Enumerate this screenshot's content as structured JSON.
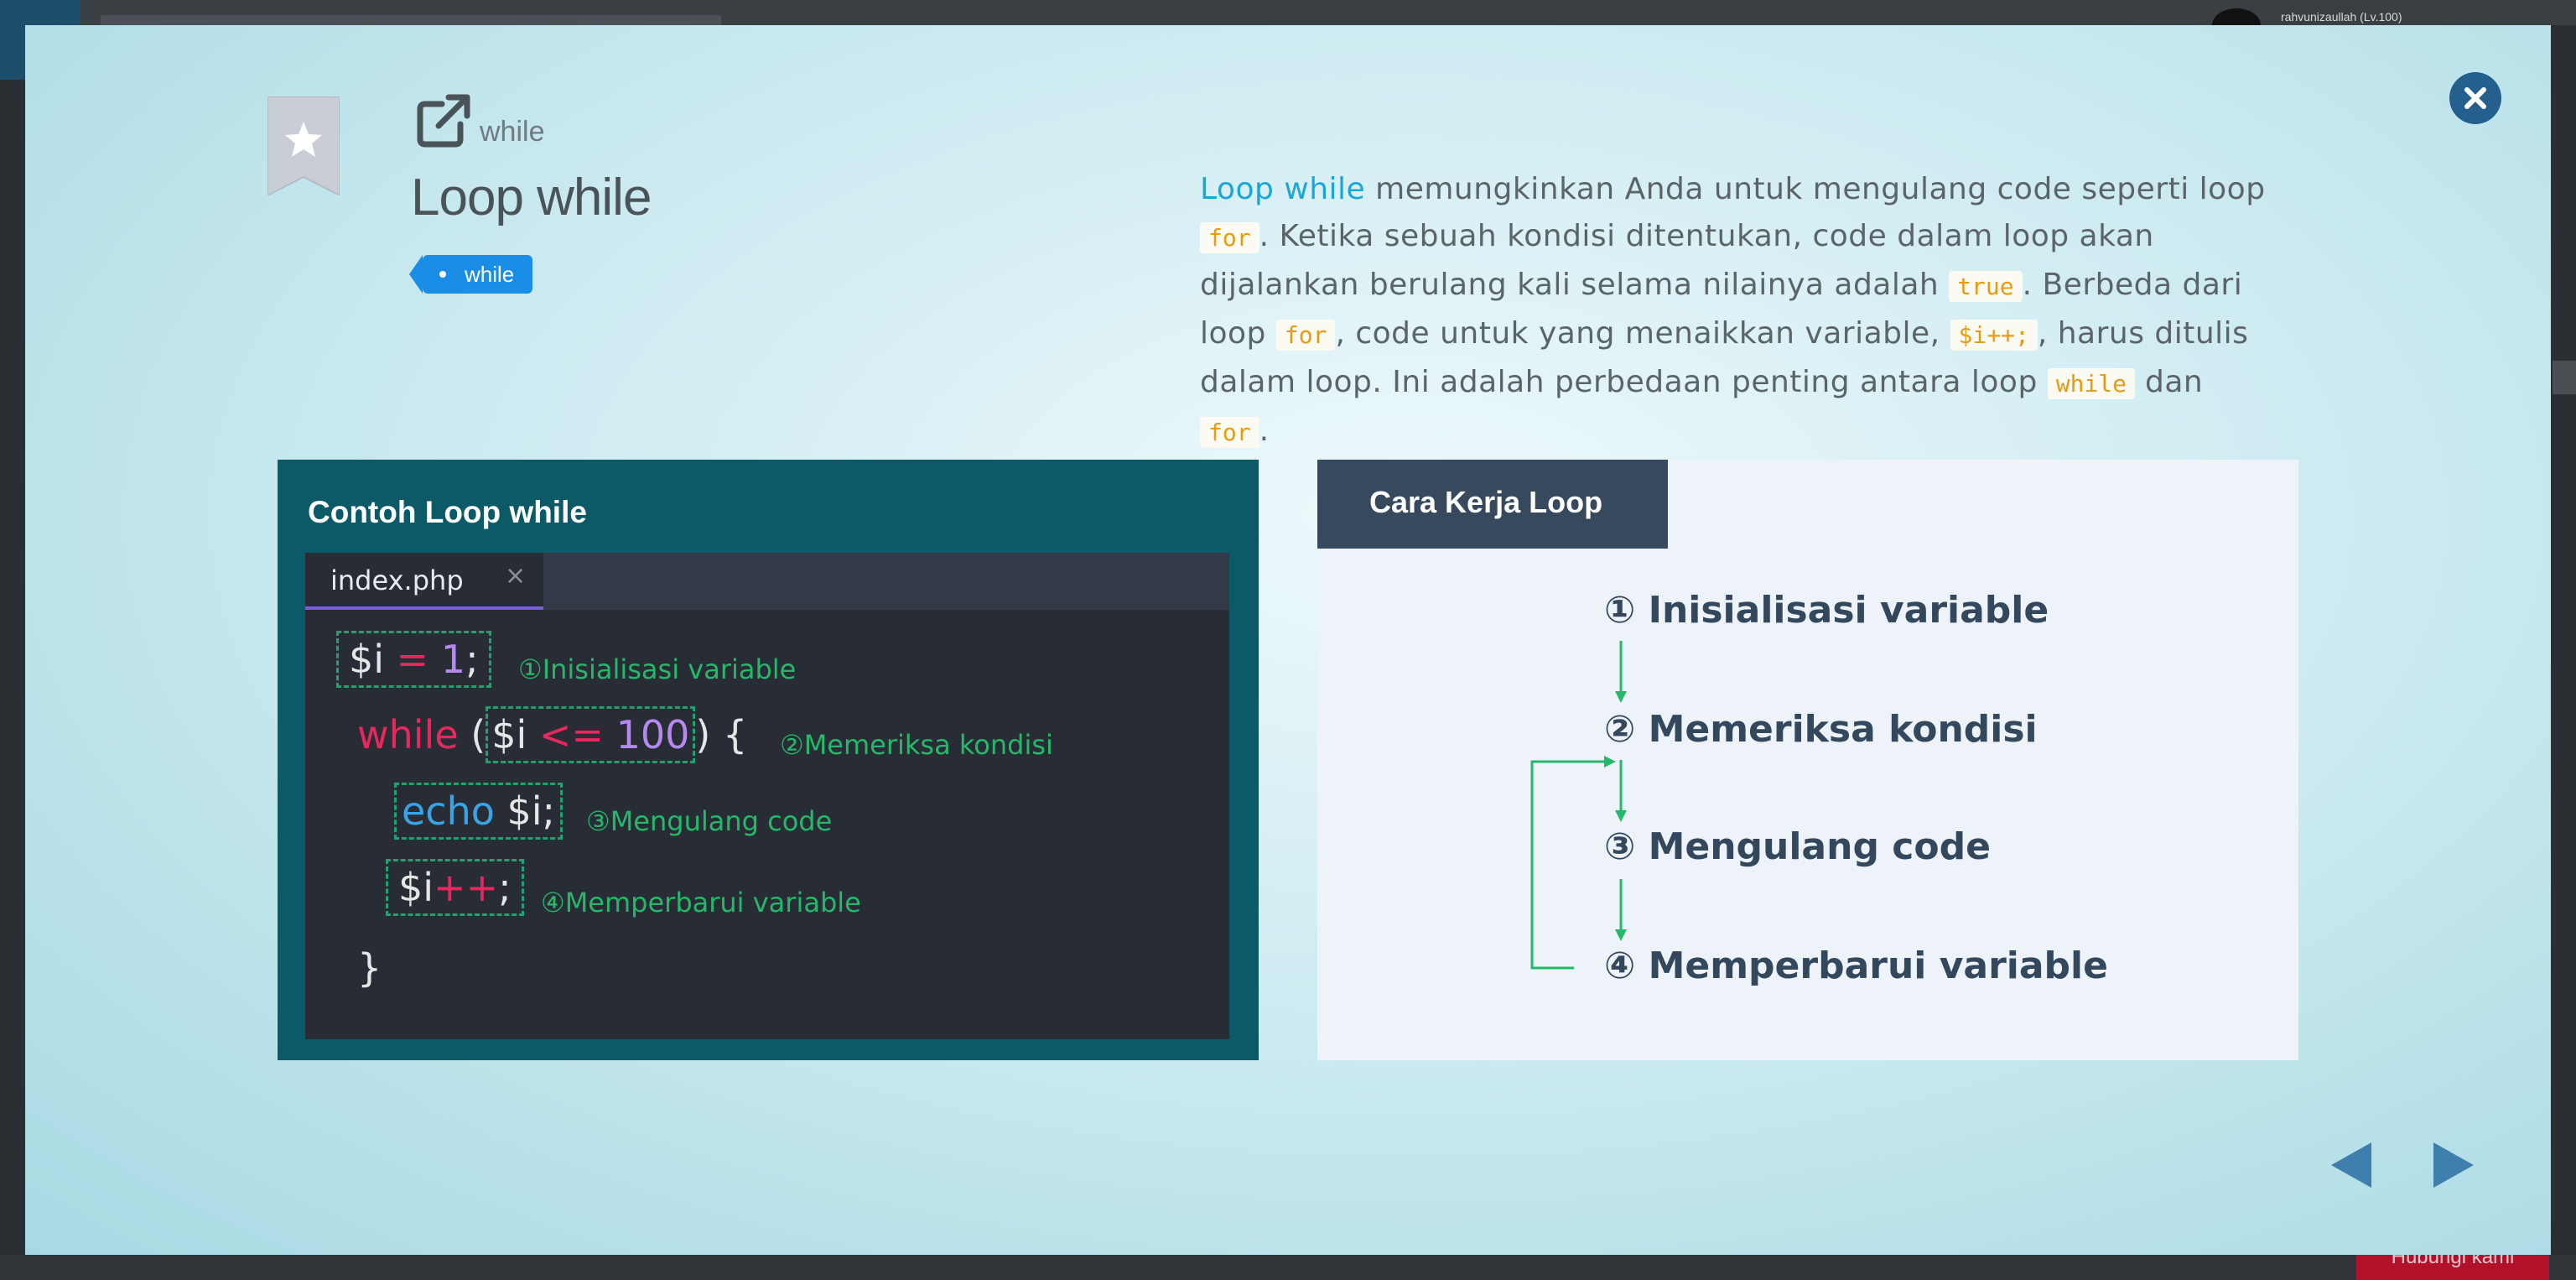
{
  "backdrop": {
    "user_label": "rahvunizaullah (Lv.100)",
    "bottom_button_label": "Hubungi kami"
  },
  "modal": {
    "keyword": "while",
    "title": "Loop while",
    "tag_label": "while",
    "description": {
      "highlight": "Loop while",
      "t1": " memungkinkan Anda untuk mengulang code seperti loop ",
      "c1": "for",
      "t2": ". Ketika sebuah kondisi ditentukan, code dalam loop akan dijalankan berulang kali selama nilainya adalah ",
      "c2": "true",
      "t3": ". Berbeda dari loop ",
      "c3": "for",
      "t4": ", code untuk yang menaikkan variable, ",
      "c4": "$i++;",
      "t5": ", harus ditulis dalam loop. Ini adalah perbedaan penting antara loop ",
      "c5": "while",
      "t6": " dan ",
      "c6": "for",
      "t7": "."
    }
  },
  "code_panel": {
    "title": "Contoh Loop while",
    "tab_label": "index.php",
    "tab_close": "×",
    "lines": {
      "l1_var": "$i",
      "l1_op": " = ",
      "l1_num": "1",
      "l1_end": ";",
      "l2_kw": "while",
      "l2_open": " (",
      "l2_var": "$i",
      "l2_op": " <= ",
      "l2_num": "100",
      "l2_close": ") {",
      "l3_fn": "echo",
      "l3_rest": " $i;",
      "l4_var": "$i",
      "l4_op": "++",
      "l4_end": ";",
      "l5": "}"
    },
    "notes": {
      "n1": "①Inisialisasi  variable",
      "n2": "②Memeriksa  kondisi",
      "n3": "③Mengulang  code",
      "n4": "④Memperbarui  variable"
    }
  },
  "flow_panel": {
    "header": "Cara Kerja Loop",
    "steps": [
      "① Inisialisasi variable",
      "② Memeriksa kondisi",
      "③ Mengulang code",
      "④ Memperbarui variable"
    ]
  },
  "colors": {
    "accent_blue": "#1a8ee6",
    "keyword_pink": "#e8275f",
    "number_purple": "#b788f0",
    "note_green": "#26b86a",
    "close_button": "#245f8e",
    "nav_arrow": "#3f7fad"
  },
  "icons": {
    "close": "close-icon",
    "bookmark": "bookmark-star-icon",
    "external": "external-link-icon",
    "prev": "triangle-left-icon",
    "next": "triangle-right-icon"
  }
}
